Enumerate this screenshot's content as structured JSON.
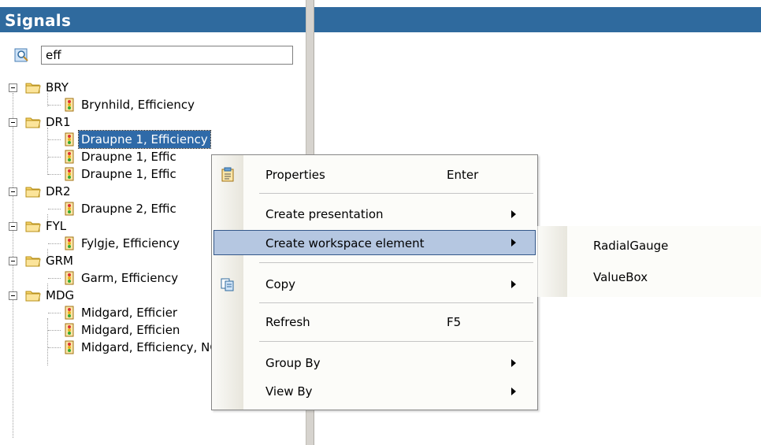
{
  "panel": {
    "title": "Signals"
  },
  "search": {
    "value": "eff"
  },
  "tree": {
    "groups": [
      {
        "label": "BRY",
        "children": [
          "Brynhild, Efficiency"
        ]
      },
      {
        "label": "DR1",
        "children": [
          "Draupne 1, Efficiency",
          "Draupne 1, Effic",
          "Draupne 1, Effic"
        ]
      },
      {
        "label": "DR2",
        "children": [
          "Draupne 2, Effic"
        ]
      },
      {
        "label": "FYL",
        "children": [
          "Fylgje, Efficiency"
        ]
      },
      {
        "label": "GRM",
        "children": [
          "Garm, Efficiency"
        ]
      },
      {
        "label": "MDG",
        "children": [
          "Midgard, Efficier",
          "Midgard, Efficien",
          "Midgard, Efficiency, NGL"
        ]
      }
    ]
  },
  "context_menu": {
    "items": [
      {
        "label": "Properties",
        "shortcut": "Enter"
      },
      {
        "label": "Create presentation",
        "shortcut": ""
      },
      {
        "label": "Create workspace element",
        "shortcut": ""
      },
      {
        "label": "Copy",
        "shortcut": ""
      },
      {
        "label": "Refresh",
        "shortcut": "F5"
      },
      {
        "label": "Group By",
        "shortcut": ""
      },
      {
        "label": "View By",
        "shortcut": ""
      }
    ]
  },
  "submenu": {
    "items": [
      "RadialGauge",
      "ValueBox"
    ]
  },
  "colors": {
    "header": "#2f6a9e",
    "selection": "#2f6aa8",
    "menu_highlight": "#b5c7e1"
  }
}
